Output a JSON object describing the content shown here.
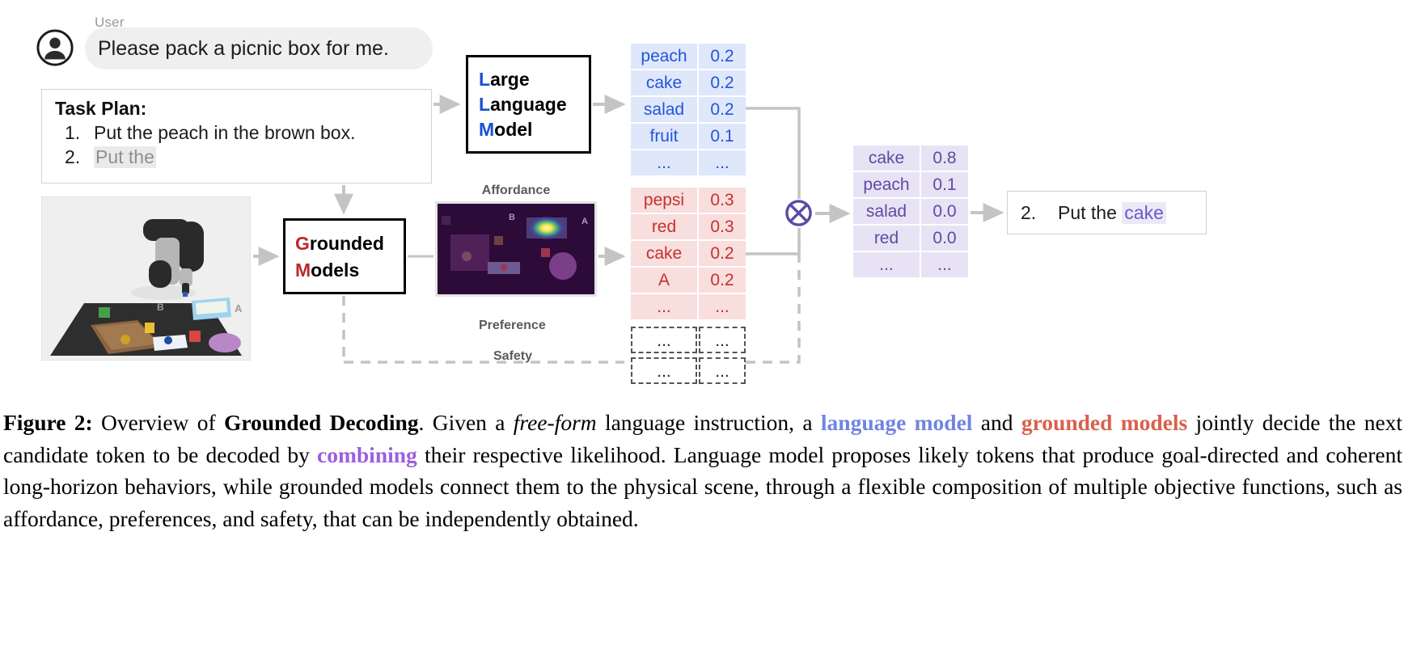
{
  "user": {
    "label": "User",
    "message": "Please pack a picnic box for me."
  },
  "task_plan": {
    "title": "Task Plan:",
    "steps": [
      {
        "num": "1.",
        "text": "Put the peach in the brown box.",
        "muted": false
      },
      {
        "num": "2.",
        "text": "Put the",
        "muted": true
      }
    ]
  },
  "llm_box": {
    "lines": [
      {
        "cap": "L",
        "rest": "arge"
      },
      {
        "cap": "L",
        "rest": "anguage"
      },
      {
        "cap": "M",
        "rest": "odel"
      }
    ],
    "accent_color": "#1a4fd6"
  },
  "grounded_box": {
    "lines": [
      {
        "cap": "G",
        "rest": "rounded"
      },
      {
        "cap": "M",
        "rest": "odels"
      }
    ],
    "accent_color": "#c0272d"
  },
  "affordance": {
    "label": "Affordance",
    "markers": [
      "B",
      "A"
    ]
  },
  "preference": {
    "label": "Preference",
    "token": "...",
    "prob": "..."
  },
  "safety": {
    "label": "Safety",
    "token": "...",
    "prob": "..."
  },
  "combine": {
    "symbol": "⊗"
  },
  "output": {
    "num": "2.",
    "prefix": "Put the",
    "token": "cake"
  },
  "chart_data": {
    "type": "table",
    "title": "Grounded Decoding token distributions",
    "tables": [
      {
        "name": "language_model",
        "color": "#2255d8",
        "bg": "#dfe7fb",
        "rows": [
          {
            "token": "peach",
            "prob": "0.2"
          },
          {
            "token": "cake",
            "prob": "0.2"
          },
          {
            "token": "salad",
            "prob": "0.2"
          },
          {
            "token": "fruit",
            "prob": "0.1"
          },
          {
            "token": "...",
            "prob": "..."
          }
        ]
      },
      {
        "name": "grounded_affordance",
        "color": "#c5302f",
        "bg": "#f8dedd",
        "rows": [
          {
            "token": "pepsi",
            "prob": "0.3"
          },
          {
            "token": "red",
            "prob": "0.3"
          },
          {
            "token": "cake",
            "prob": "0.2"
          },
          {
            "token": "A",
            "prob": "0.2"
          },
          {
            "token": "...",
            "prob": "..."
          }
        ]
      },
      {
        "name": "combined",
        "color": "#5b4ba3",
        "bg": "#e7e3f4",
        "rows": [
          {
            "token": "cake",
            "prob": "0.8"
          },
          {
            "token": "peach",
            "prob": "0.1"
          },
          {
            "token": "salad",
            "prob": "0.0"
          },
          {
            "token": "red",
            "prob": "0.0"
          },
          {
            "token": "...",
            "prob": "..."
          }
        ]
      }
    ]
  },
  "caption": {
    "figure_label": "Figure 2:",
    "t1": " Overview of ",
    "bold1": "Grounded Decoding",
    "t2": ". Given a ",
    "italic1": "free-form",
    "t3": " language instruction, a ",
    "blue1": "language model",
    "t4": " and ",
    "red1": "grounded models",
    "t5": " jointly decide the next candidate token to be decoded by ",
    "purple1": "combining",
    "t6": " their respective likelihood. Language model proposes likely tokens that produce goal-directed and coherent long-horizon behaviors, while grounded models connect them to the physical scene, through a flexible composition of multiple objective functions, such as affordance, preferences, and safety, that can be independently obtained."
  }
}
